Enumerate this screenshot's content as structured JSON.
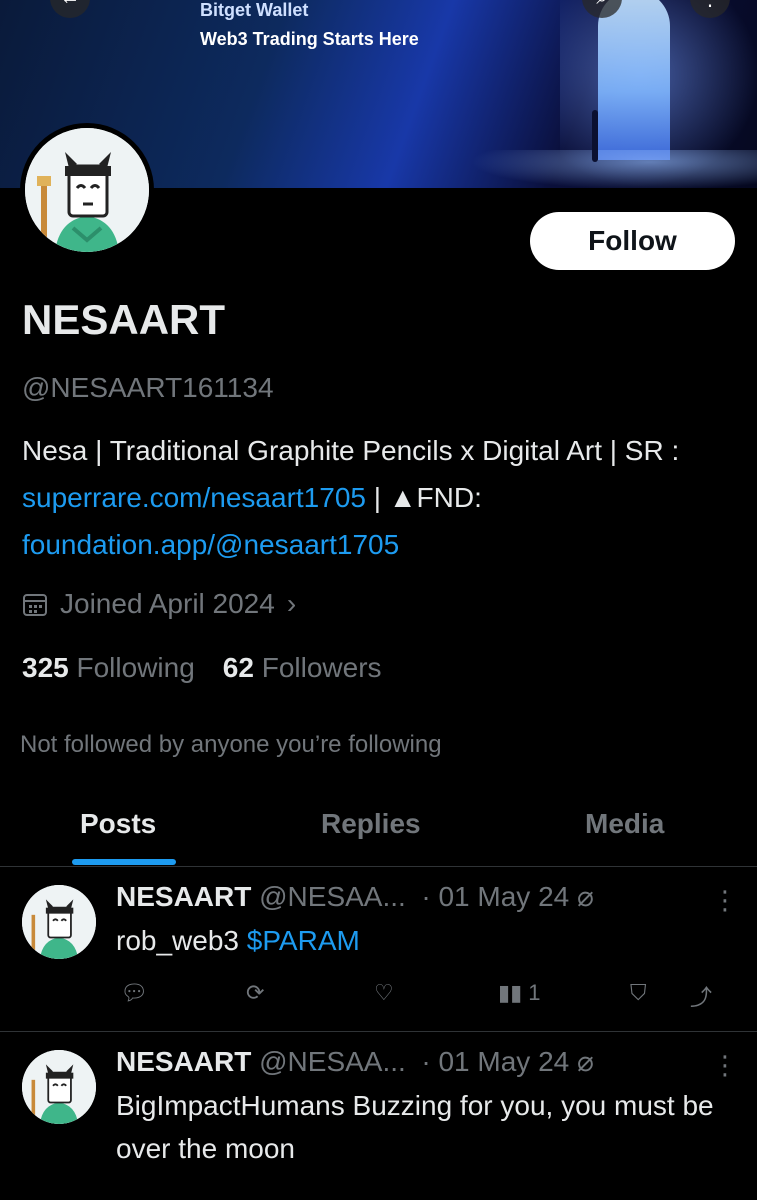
{
  "banner": {
    "brand": "Bitget Wallet",
    "tagline": "Web3 Trading Starts Here"
  },
  "profile": {
    "follow_label": "Follow",
    "name": "NESAART",
    "handle": "@NESAART161134",
    "bio_prefix": "Nesa | Traditional Graphite Pencils x Digital Art | SR : ",
    "bio_link1": "superrare.com/nesaart1705",
    "bio_mid": " | ▲FND: ",
    "bio_link2": "foundation.app/@nesaart1705",
    "joined": "Joined April 2024",
    "following_count": "325",
    "following_label": "Following",
    "followers_count": "62",
    "followers_label": "Followers",
    "not_followed": "Not followed by anyone you’re following"
  },
  "tabs": [
    {
      "label": "Posts"
    },
    {
      "label": "Replies"
    },
    {
      "label": "Media"
    }
  ],
  "posts": [
    {
      "name": "NESAART",
      "handle": "@NESAA...",
      "date": "· 01 May 24",
      "text_plain": "rob_web3 ",
      "cashtag": "$PARAM",
      "views": "1"
    },
    {
      "name": "NESAART",
      "handle": "@NESAA...",
      "date": "· 01 May 24",
      "text_plain": "BigImpactHumans Buzzing for you, you must be over the moon"
    }
  ],
  "colors": {
    "accent": "#1d9bf0",
    "background": "#000000",
    "muted": "#71767b",
    "text": "#e7e9ea"
  }
}
